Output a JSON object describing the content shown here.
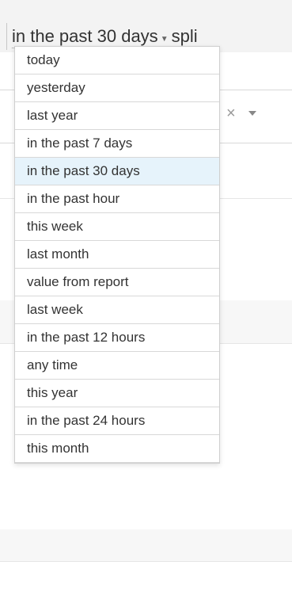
{
  "header": {
    "date_range_value": "in the past 30 days",
    "split_label": "spli"
  },
  "date_options": {
    "selected": "in the past 30 days",
    "items": [
      "today",
      "yesterday",
      "last year",
      "in the past 7 days",
      "in the past 30 days",
      "in the past hour",
      "this week",
      "last month",
      "value from report",
      "last week",
      "in the past 12 hours",
      "any time",
      "this year",
      "in the past 24 hours",
      "this month"
    ]
  },
  "filter": {
    "clear_icon": "×"
  },
  "icons": {
    "clear": "close-icon",
    "dropdown": "chevron-down-icon"
  },
  "colors": {
    "selected_item_bg": "#e6f3fb",
    "border": "#d8d8d8"
  }
}
